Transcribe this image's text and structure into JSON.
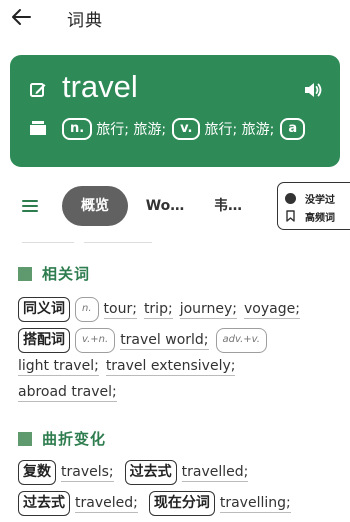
{
  "appbar": {
    "title": "词典"
  },
  "card": {
    "word": "travel",
    "pos_entries": [
      {
        "pos": "n.",
        "definition": "旅行; 旅游;"
      },
      {
        "pos": "v.",
        "definition": "旅行; 旅游;"
      },
      {
        "pos": "a",
        "definition": ""
      }
    ]
  },
  "tabs": {
    "items": [
      "概览",
      "Wo…",
      "韦…"
    ],
    "active_index": 0
  },
  "legend": {
    "learned_label": "没学过",
    "frequent_label": "高频词"
  },
  "related": {
    "title": "相关词",
    "synonym_label": "同义词",
    "synonym_pos": "n.",
    "synonyms": [
      "tour;",
      "trip;",
      "journey;",
      "voyage;"
    ],
    "collocation_label": "搭配词",
    "collocation_pos_1": "v.+n.",
    "collocation_1": "travel world;",
    "collocation_pos_2": "adv.+v.",
    "collocations_2": [
      "light travel;",
      "travel extensively;",
      "abroad travel;"
    ]
  },
  "inflection": {
    "title": "曲折变化",
    "plural_label": "复数",
    "plural": "travels;",
    "past_label_1": "过去式",
    "past_1": "travelled;",
    "past_label_2": "过去式",
    "past_2": "traveled;",
    "present_participle_label": "现在分词",
    "present_participle": "travelling;"
  },
  "colors": {
    "card_background": "#2e8b57",
    "section_accent": "#2e7d4f",
    "active_tab": "#616161"
  }
}
